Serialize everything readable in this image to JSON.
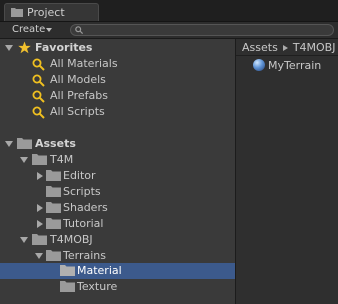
{
  "window": {
    "tab_label": "Project",
    "tab_icon": "project-folder-icon"
  },
  "toolbar": {
    "create_label": "Create",
    "search_placeholder": "",
    "search_icon": "search-icon"
  },
  "favorites": {
    "label": "Favorites",
    "icon": "star-icon",
    "items": [
      {
        "label": "All Materials",
        "icon": "search-icon"
      },
      {
        "label": "All Models",
        "icon": "search-icon"
      },
      {
        "label": "All Prefabs",
        "icon": "search-icon"
      },
      {
        "label": "All Scripts",
        "icon": "search-icon"
      }
    ]
  },
  "assets_tree": {
    "root_label": "Assets",
    "nodes": [
      {
        "label": "T4M"
      },
      {
        "label": "Editor"
      },
      {
        "label": "Scripts"
      },
      {
        "label": "Shaders"
      },
      {
        "label": "Tutorial"
      },
      {
        "label": "T4MOBJ"
      },
      {
        "label": "Terrains"
      },
      {
        "label": "Material",
        "selected": true
      },
      {
        "label": "Texture"
      }
    ]
  },
  "right_panel": {
    "breadcrumb": [
      "Assets",
      "T4MOBJ"
    ],
    "items": [
      {
        "label": "MyTerrain",
        "icon": "terrain-sphere-icon"
      }
    ]
  },
  "colors": {
    "selection": "#3c5a8c",
    "folder": "#9a9a9a",
    "star": "#f2c12e",
    "search_glass": "#f0c020"
  }
}
